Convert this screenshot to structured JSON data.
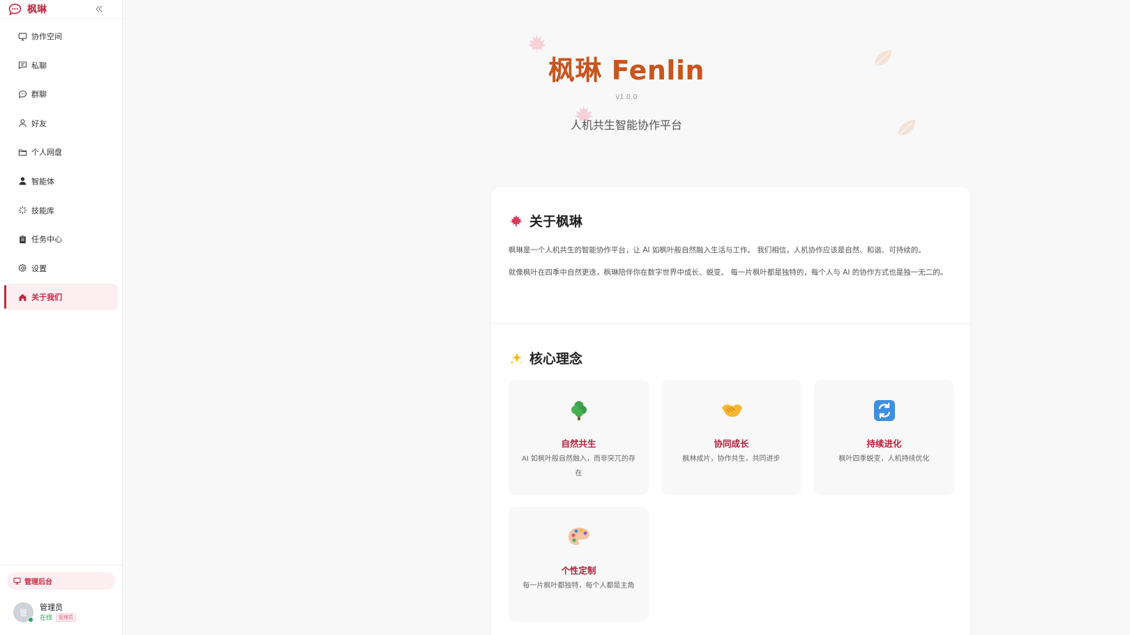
{
  "sidebar": {
    "app_name": "枫琳",
    "items": [
      {
        "label": "协作空间",
        "icon": "monitor-icon"
      },
      {
        "label": "私聊",
        "icon": "message-square-icon"
      },
      {
        "label": "群聊",
        "icon": "chat-bubble-icon"
      },
      {
        "label": "好友",
        "icon": "user-icon"
      },
      {
        "label": "个人网盘",
        "icon": "folder-icon"
      },
      {
        "label": "智能体",
        "icon": "user-filled-icon"
      },
      {
        "label": "技能库",
        "icon": "loader-icon"
      },
      {
        "label": "任务中心",
        "icon": "clipboard-icon"
      },
      {
        "label": "设置",
        "icon": "gear-icon"
      },
      {
        "label": "关于我们",
        "icon": "home-icon",
        "active": true
      }
    ],
    "admin_label": "管理后台",
    "user": {
      "name": "管理员",
      "avatar_text": "管",
      "status": "在线",
      "role": "管理员"
    }
  },
  "hero": {
    "title": "枫琳 Fenlin",
    "version": "v1.0.0",
    "subtitle": "人机共生智能协作平台"
  },
  "about": {
    "title": "关于枫琳",
    "p1": "枫琳是一个人机共生的智能协作平台，让 AI 如枫叶般自然融入生活与工作。 我们相信，人机协作应该是自然、和谐、可持续的。",
    "p2": "就像枫叶在四季中自然更迭，枫琳陪伴你在数字世界中成长、蜕变。 每一片枫叶都是独特的，每个人与 AI 的协作方式也是独一无二的。"
  },
  "core": {
    "title": "核心理念",
    "features": [
      {
        "title": "自然共生",
        "desc": "AI 如枫叶般自然融入，而非突兀的存在",
        "icon": "tree-icon"
      },
      {
        "title": "协同成长",
        "desc": "枫林成片，协作共生，共同进步",
        "icon": "handshake-icon"
      },
      {
        "title": "持续进化",
        "desc": "枫叶四季蜕变，人机持续优化",
        "icon": "refresh-icon"
      },
      {
        "title": "个性定制",
        "desc": "每一片枫叶都独特，每个人都是主角",
        "icon": "palette-icon"
      }
    ]
  },
  "colors": {
    "accent": "#c0283f",
    "title_orange": "#c8551c",
    "active_bg": "#fdeef1",
    "online": "#23a55a"
  }
}
